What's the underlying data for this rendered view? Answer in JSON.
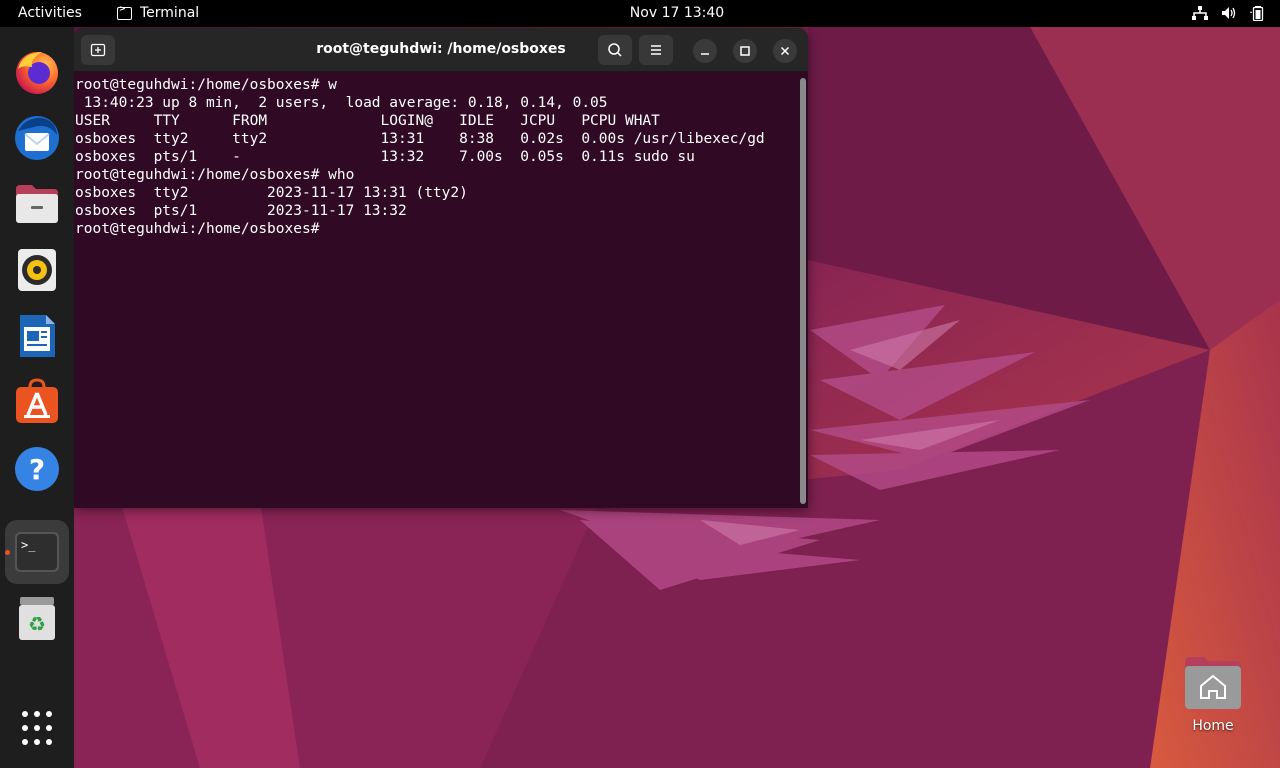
{
  "topbar": {
    "activities": "Activities",
    "app_name": "Terminal",
    "clock": "Nov 17  13:40"
  },
  "dock": {
    "apps": [
      {
        "name": "Firefox",
        "icon": "firefox-icon"
      },
      {
        "name": "Thunderbird",
        "icon": "thunderbird-icon"
      },
      {
        "name": "Files",
        "icon": "files-icon"
      },
      {
        "name": "Rhythmbox",
        "icon": "rhythmbox-icon"
      },
      {
        "name": "LibreOffice Writer",
        "icon": "writer-icon"
      },
      {
        "name": "Ubuntu Software",
        "icon": "software-icon"
      },
      {
        "name": "Help",
        "icon": "help-icon"
      },
      {
        "name": "Terminal",
        "icon": "terminal-icon",
        "running": true
      },
      {
        "name": "Trash",
        "icon": "trash-icon"
      },
      {
        "name": "Show Applications",
        "icon": "app-grid-icon"
      }
    ]
  },
  "terminal": {
    "title": "root@teguhdwi: /home/osboxes",
    "lines": [
      "root@teguhdwi:/home/osboxes# w",
      " 13:40:23 up 8 min,  2 users,  load average: 0.18, 0.14, 0.05",
      "USER     TTY      FROM             LOGIN@   IDLE   JCPU   PCPU WHAT",
      "osboxes  tty2     tty2             13:31    8:38   0.02s  0.00s /usr/libexec/gd",
      "osboxes  pts/1    -                13:32    7.00s  0.05s  0.11s sudo su",
      "root@teguhdwi:/home/osboxes# who",
      "osboxes  tty2         2023-11-17 13:31 (tty2)",
      "osboxes  pts/1        2023-11-17 13:32",
      "root@teguhdwi:/home/osboxes# "
    ]
  },
  "desktop": {
    "home_label": "Home"
  },
  "colors": {
    "terminal_bg": "#300a24",
    "accent": "#e95420"
  }
}
